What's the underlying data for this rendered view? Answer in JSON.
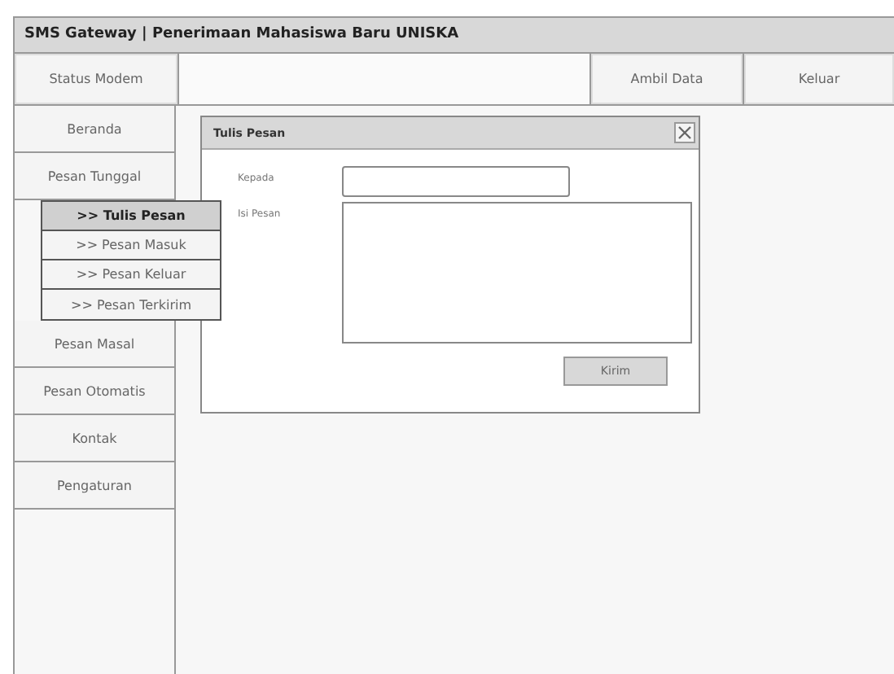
{
  "window": {
    "title": "SMS Gateway | Penerimaan Mahasiswa Baru UNISKA"
  },
  "toolbar": {
    "status_button": "Status Modem",
    "buttons": [
      "Ambil Data",
      "Keluar"
    ]
  },
  "sidebar": {
    "items": [
      {
        "label": "Beranda"
      },
      {
        "label": "Pesan Tunggal",
        "children": [
          {
            "label": ">> Tulis Pesan",
            "selected": true
          },
          {
            "label": ">> Pesan Masuk",
            "selected": false
          },
          {
            "label": ">> Pesan Keluar",
            "selected": false
          },
          {
            "label": ">> Pesan Terkirim",
            "selected": false
          }
        ]
      },
      {
        "label": "Pesan Masal"
      },
      {
        "label": "Pesan Otomatis"
      },
      {
        "label": "Kontak"
      },
      {
        "label": "Pengaturan"
      }
    ]
  },
  "dialog": {
    "title": "Tulis Pesan",
    "to_label": "Kepada",
    "message_label": "Isi Pesan",
    "send_button": "Kirim"
  }
}
